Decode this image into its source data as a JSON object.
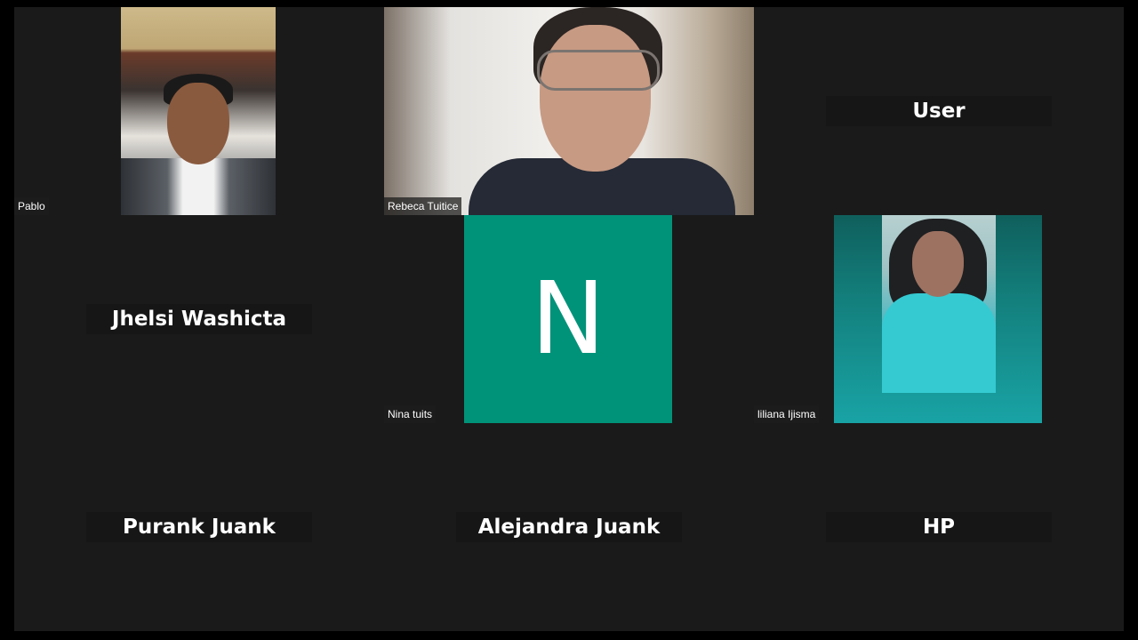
{
  "participants": [
    {
      "name": "Pablo",
      "type": "video"
    },
    {
      "name": "Rebeca Tuitice",
      "type": "video"
    },
    {
      "name": "User",
      "type": "name-only"
    },
    {
      "name": "Jhelsi Washicta",
      "type": "name-only"
    },
    {
      "name": "Nina tuits",
      "type": "avatar",
      "initial": "N",
      "avatar_color": "#00937a"
    },
    {
      "name": "liliana Ijisma",
      "type": "video"
    },
    {
      "name": "Purank Juank",
      "type": "name-only"
    },
    {
      "name": "Alejandra Juank",
      "type": "name-only"
    },
    {
      "name": "HP",
      "type": "name-only"
    }
  ],
  "colors": {
    "background": "#1a1a1a",
    "frame": "#000000"
  }
}
